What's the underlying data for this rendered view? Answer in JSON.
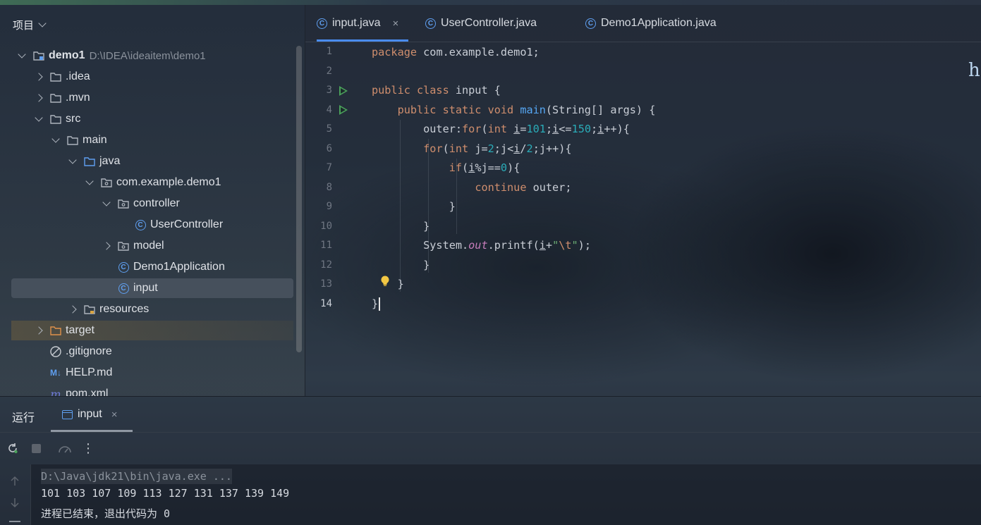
{
  "project_panel": {
    "title": "项目",
    "tree": [
      {
        "label": "demo1",
        "path": "D:\\IDEA\\ideaitem\\demo1",
        "kind": "module",
        "level": 0,
        "expanded": true
      },
      {
        "label": ".idea",
        "kind": "folder",
        "level": 1,
        "expanded": false
      },
      {
        "label": ".mvn",
        "kind": "folder",
        "level": 1,
        "expanded": false
      },
      {
        "label": "src",
        "kind": "folder",
        "level": 1,
        "expanded": true
      },
      {
        "label": "main",
        "kind": "folder",
        "level": 2,
        "expanded": true
      },
      {
        "label": "java",
        "kind": "source-folder",
        "level": 3,
        "expanded": true
      },
      {
        "label": "com.example.demo1",
        "kind": "package",
        "level": 4,
        "expanded": true
      },
      {
        "label": "controller",
        "kind": "package",
        "level": 5,
        "expanded": true
      },
      {
        "label": "UserController",
        "kind": "class",
        "level": 6
      },
      {
        "label": "model",
        "kind": "package",
        "level": 5,
        "expanded": false
      },
      {
        "label": "Demo1Application",
        "kind": "spring-class",
        "level": 5
      },
      {
        "label": "input",
        "kind": "class",
        "level": 5,
        "selected": true
      },
      {
        "label": "resources",
        "kind": "resources-folder",
        "level": 3,
        "expanded": false
      },
      {
        "label": "target",
        "kind": "excluded-folder",
        "level": 1,
        "expanded": false
      },
      {
        "label": ".gitignore",
        "kind": "ignore-file",
        "level": 1
      },
      {
        "label": "HELP.md",
        "kind": "markdown-file",
        "level": 1
      },
      {
        "label": "pom.xml",
        "kind": "maven-file",
        "level": 1
      }
    ]
  },
  "editor": {
    "tabs": [
      {
        "label": "input.java",
        "active": true,
        "close": "×"
      },
      {
        "label": "UserController.java",
        "active": false
      },
      {
        "label": "Demo1Application.java",
        "active": false
      }
    ],
    "line_numbers": [
      "1",
      "2",
      "3",
      "4",
      "5",
      "6",
      "7",
      "8",
      "9",
      "10",
      "11",
      "12",
      "13",
      "14"
    ],
    "current_line": "14",
    "corner_text": "he"
  },
  "run_panel": {
    "title": "运行",
    "tab_label": "input",
    "tab_close": "×",
    "console": {
      "command": "D:\\Java\\jdk21\\bin\\java.exe ...",
      "output": "101 103 107 109 113 127 131 137 139 149",
      "exit": "进程已结束，退出代码为 0"
    }
  },
  "colors": {
    "accent": "#4a8cf0",
    "keyword": "#cf8e6d",
    "number": "#2aacb8",
    "function": "#56a8f5",
    "string": "#6aab73",
    "run_icon": "#4aa15a"
  }
}
